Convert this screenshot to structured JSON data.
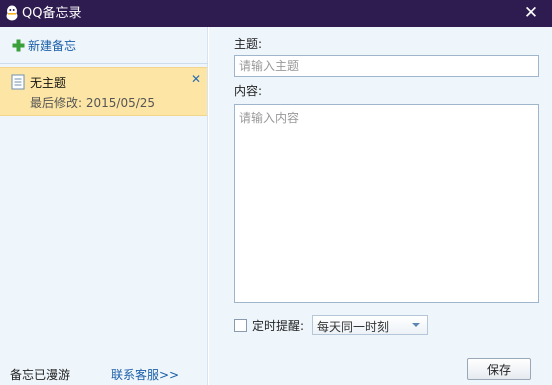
{
  "window": {
    "title": "QQ备忘录",
    "close_symbol": "✕"
  },
  "sidebar": {
    "new_note_label": "新建备忘",
    "notes": [
      {
        "title": "无主题",
        "modified": "最后修改: 2015/05/25",
        "delete_symbol": "✕"
      }
    ],
    "roam_status": "备忘已漫游",
    "support_link": "联系客服>>"
  },
  "editor": {
    "subject_label": "主题:",
    "subject_placeholder": "请输入主题",
    "content_label": "内容:",
    "content_placeholder": "请输入内容",
    "reminder": {
      "label": "定时提醒:",
      "checked": false,
      "selected_option": "每天同一时刻"
    },
    "save_label": "保存"
  },
  "colors": {
    "titlebar": "#2e1b4f",
    "panel_bg": "#eef5fb",
    "selected_note": "#fde6a5",
    "link": "#1a5fa8"
  }
}
